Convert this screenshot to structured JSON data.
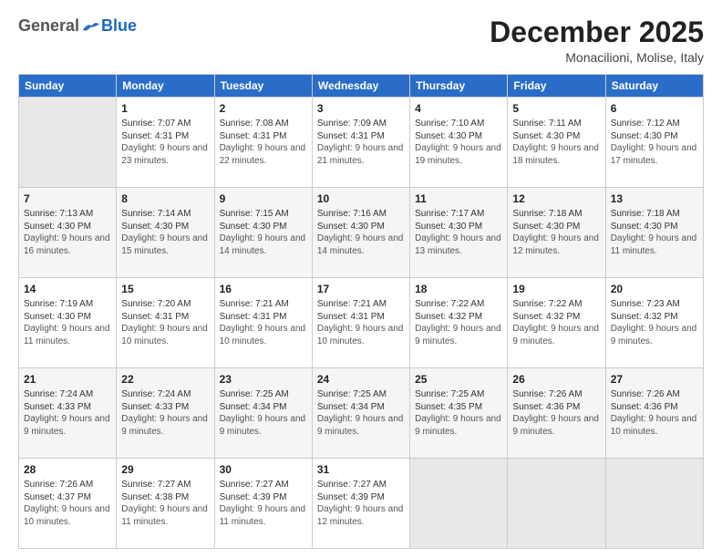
{
  "header": {
    "logo_general": "General",
    "logo_blue": "Blue",
    "month": "December 2025",
    "location": "Monacilioni, Molise, Italy"
  },
  "weekdays": [
    "Sunday",
    "Monday",
    "Tuesday",
    "Wednesday",
    "Thursday",
    "Friday",
    "Saturday"
  ],
  "weeks": [
    [
      {
        "day": "",
        "sunrise": "",
        "sunset": "",
        "daylight": ""
      },
      {
        "day": "1",
        "sunrise": "Sunrise: 7:07 AM",
        "sunset": "Sunset: 4:31 PM",
        "daylight": "Daylight: 9 hours and 23 minutes."
      },
      {
        "day": "2",
        "sunrise": "Sunrise: 7:08 AM",
        "sunset": "Sunset: 4:31 PM",
        "daylight": "Daylight: 9 hours and 22 minutes."
      },
      {
        "day": "3",
        "sunrise": "Sunrise: 7:09 AM",
        "sunset": "Sunset: 4:31 PM",
        "daylight": "Daylight: 9 hours and 21 minutes."
      },
      {
        "day": "4",
        "sunrise": "Sunrise: 7:10 AM",
        "sunset": "Sunset: 4:30 PM",
        "daylight": "Daylight: 9 hours and 19 minutes."
      },
      {
        "day": "5",
        "sunrise": "Sunrise: 7:11 AM",
        "sunset": "Sunset: 4:30 PM",
        "daylight": "Daylight: 9 hours and 18 minutes."
      },
      {
        "day": "6",
        "sunrise": "Sunrise: 7:12 AM",
        "sunset": "Sunset: 4:30 PM",
        "daylight": "Daylight: 9 hours and 17 minutes."
      }
    ],
    [
      {
        "day": "7",
        "sunrise": "Sunrise: 7:13 AM",
        "sunset": "Sunset: 4:30 PM",
        "daylight": "Daylight: 9 hours and 16 minutes."
      },
      {
        "day": "8",
        "sunrise": "Sunrise: 7:14 AM",
        "sunset": "Sunset: 4:30 PM",
        "daylight": "Daylight: 9 hours and 15 minutes."
      },
      {
        "day": "9",
        "sunrise": "Sunrise: 7:15 AM",
        "sunset": "Sunset: 4:30 PM",
        "daylight": "Daylight: 9 hours and 14 minutes."
      },
      {
        "day": "10",
        "sunrise": "Sunrise: 7:16 AM",
        "sunset": "Sunset: 4:30 PM",
        "daylight": "Daylight: 9 hours and 14 minutes."
      },
      {
        "day": "11",
        "sunrise": "Sunrise: 7:17 AM",
        "sunset": "Sunset: 4:30 PM",
        "daylight": "Daylight: 9 hours and 13 minutes."
      },
      {
        "day": "12",
        "sunrise": "Sunrise: 7:18 AM",
        "sunset": "Sunset: 4:30 PM",
        "daylight": "Daylight: 9 hours and 12 minutes."
      },
      {
        "day": "13",
        "sunrise": "Sunrise: 7:18 AM",
        "sunset": "Sunset: 4:30 PM",
        "daylight": "Daylight: 9 hours and 11 minutes."
      }
    ],
    [
      {
        "day": "14",
        "sunrise": "Sunrise: 7:19 AM",
        "sunset": "Sunset: 4:30 PM",
        "daylight": "Daylight: 9 hours and 11 minutes."
      },
      {
        "day": "15",
        "sunrise": "Sunrise: 7:20 AM",
        "sunset": "Sunset: 4:31 PM",
        "daylight": "Daylight: 9 hours and 10 minutes."
      },
      {
        "day": "16",
        "sunrise": "Sunrise: 7:21 AM",
        "sunset": "Sunset: 4:31 PM",
        "daylight": "Daylight: 9 hours and 10 minutes."
      },
      {
        "day": "17",
        "sunrise": "Sunrise: 7:21 AM",
        "sunset": "Sunset: 4:31 PM",
        "daylight": "Daylight: 9 hours and 10 minutes."
      },
      {
        "day": "18",
        "sunrise": "Sunrise: 7:22 AM",
        "sunset": "Sunset: 4:32 PM",
        "daylight": "Daylight: 9 hours and 9 minutes."
      },
      {
        "day": "19",
        "sunrise": "Sunrise: 7:22 AM",
        "sunset": "Sunset: 4:32 PM",
        "daylight": "Daylight: 9 hours and 9 minutes."
      },
      {
        "day": "20",
        "sunrise": "Sunrise: 7:23 AM",
        "sunset": "Sunset: 4:32 PM",
        "daylight": "Daylight: 9 hours and 9 minutes."
      }
    ],
    [
      {
        "day": "21",
        "sunrise": "Sunrise: 7:24 AM",
        "sunset": "Sunset: 4:33 PM",
        "daylight": "Daylight: 9 hours and 9 minutes."
      },
      {
        "day": "22",
        "sunrise": "Sunrise: 7:24 AM",
        "sunset": "Sunset: 4:33 PM",
        "daylight": "Daylight: 9 hours and 9 minutes."
      },
      {
        "day": "23",
        "sunrise": "Sunrise: 7:25 AM",
        "sunset": "Sunset: 4:34 PM",
        "daylight": "Daylight: 9 hours and 9 minutes."
      },
      {
        "day": "24",
        "sunrise": "Sunrise: 7:25 AM",
        "sunset": "Sunset: 4:34 PM",
        "daylight": "Daylight: 9 hours and 9 minutes."
      },
      {
        "day": "25",
        "sunrise": "Sunrise: 7:25 AM",
        "sunset": "Sunset: 4:35 PM",
        "daylight": "Daylight: 9 hours and 9 minutes."
      },
      {
        "day": "26",
        "sunrise": "Sunrise: 7:26 AM",
        "sunset": "Sunset: 4:36 PM",
        "daylight": "Daylight: 9 hours and 9 minutes."
      },
      {
        "day": "27",
        "sunrise": "Sunrise: 7:26 AM",
        "sunset": "Sunset: 4:36 PM",
        "daylight": "Daylight: 9 hours and 10 minutes."
      }
    ],
    [
      {
        "day": "28",
        "sunrise": "Sunrise: 7:26 AM",
        "sunset": "Sunset: 4:37 PM",
        "daylight": "Daylight: 9 hours and 10 minutes."
      },
      {
        "day": "29",
        "sunrise": "Sunrise: 7:27 AM",
        "sunset": "Sunset: 4:38 PM",
        "daylight": "Daylight: 9 hours and 11 minutes."
      },
      {
        "day": "30",
        "sunrise": "Sunrise: 7:27 AM",
        "sunset": "Sunset: 4:39 PM",
        "daylight": "Daylight: 9 hours and 11 minutes."
      },
      {
        "day": "31",
        "sunrise": "Sunrise: 7:27 AM",
        "sunset": "Sunset: 4:39 PM",
        "daylight": "Daylight: 9 hours and 12 minutes."
      },
      {
        "day": "",
        "sunrise": "",
        "sunset": "",
        "daylight": ""
      },
      {
        "day": "",
        "sunrise": "",
        "sunset": "",
        "daylight": ""
      },
      {
        "day": "",
        "sunrise": "",
        "sunset": "",
        "daylight": ""
      }
    ]
  ]
}
